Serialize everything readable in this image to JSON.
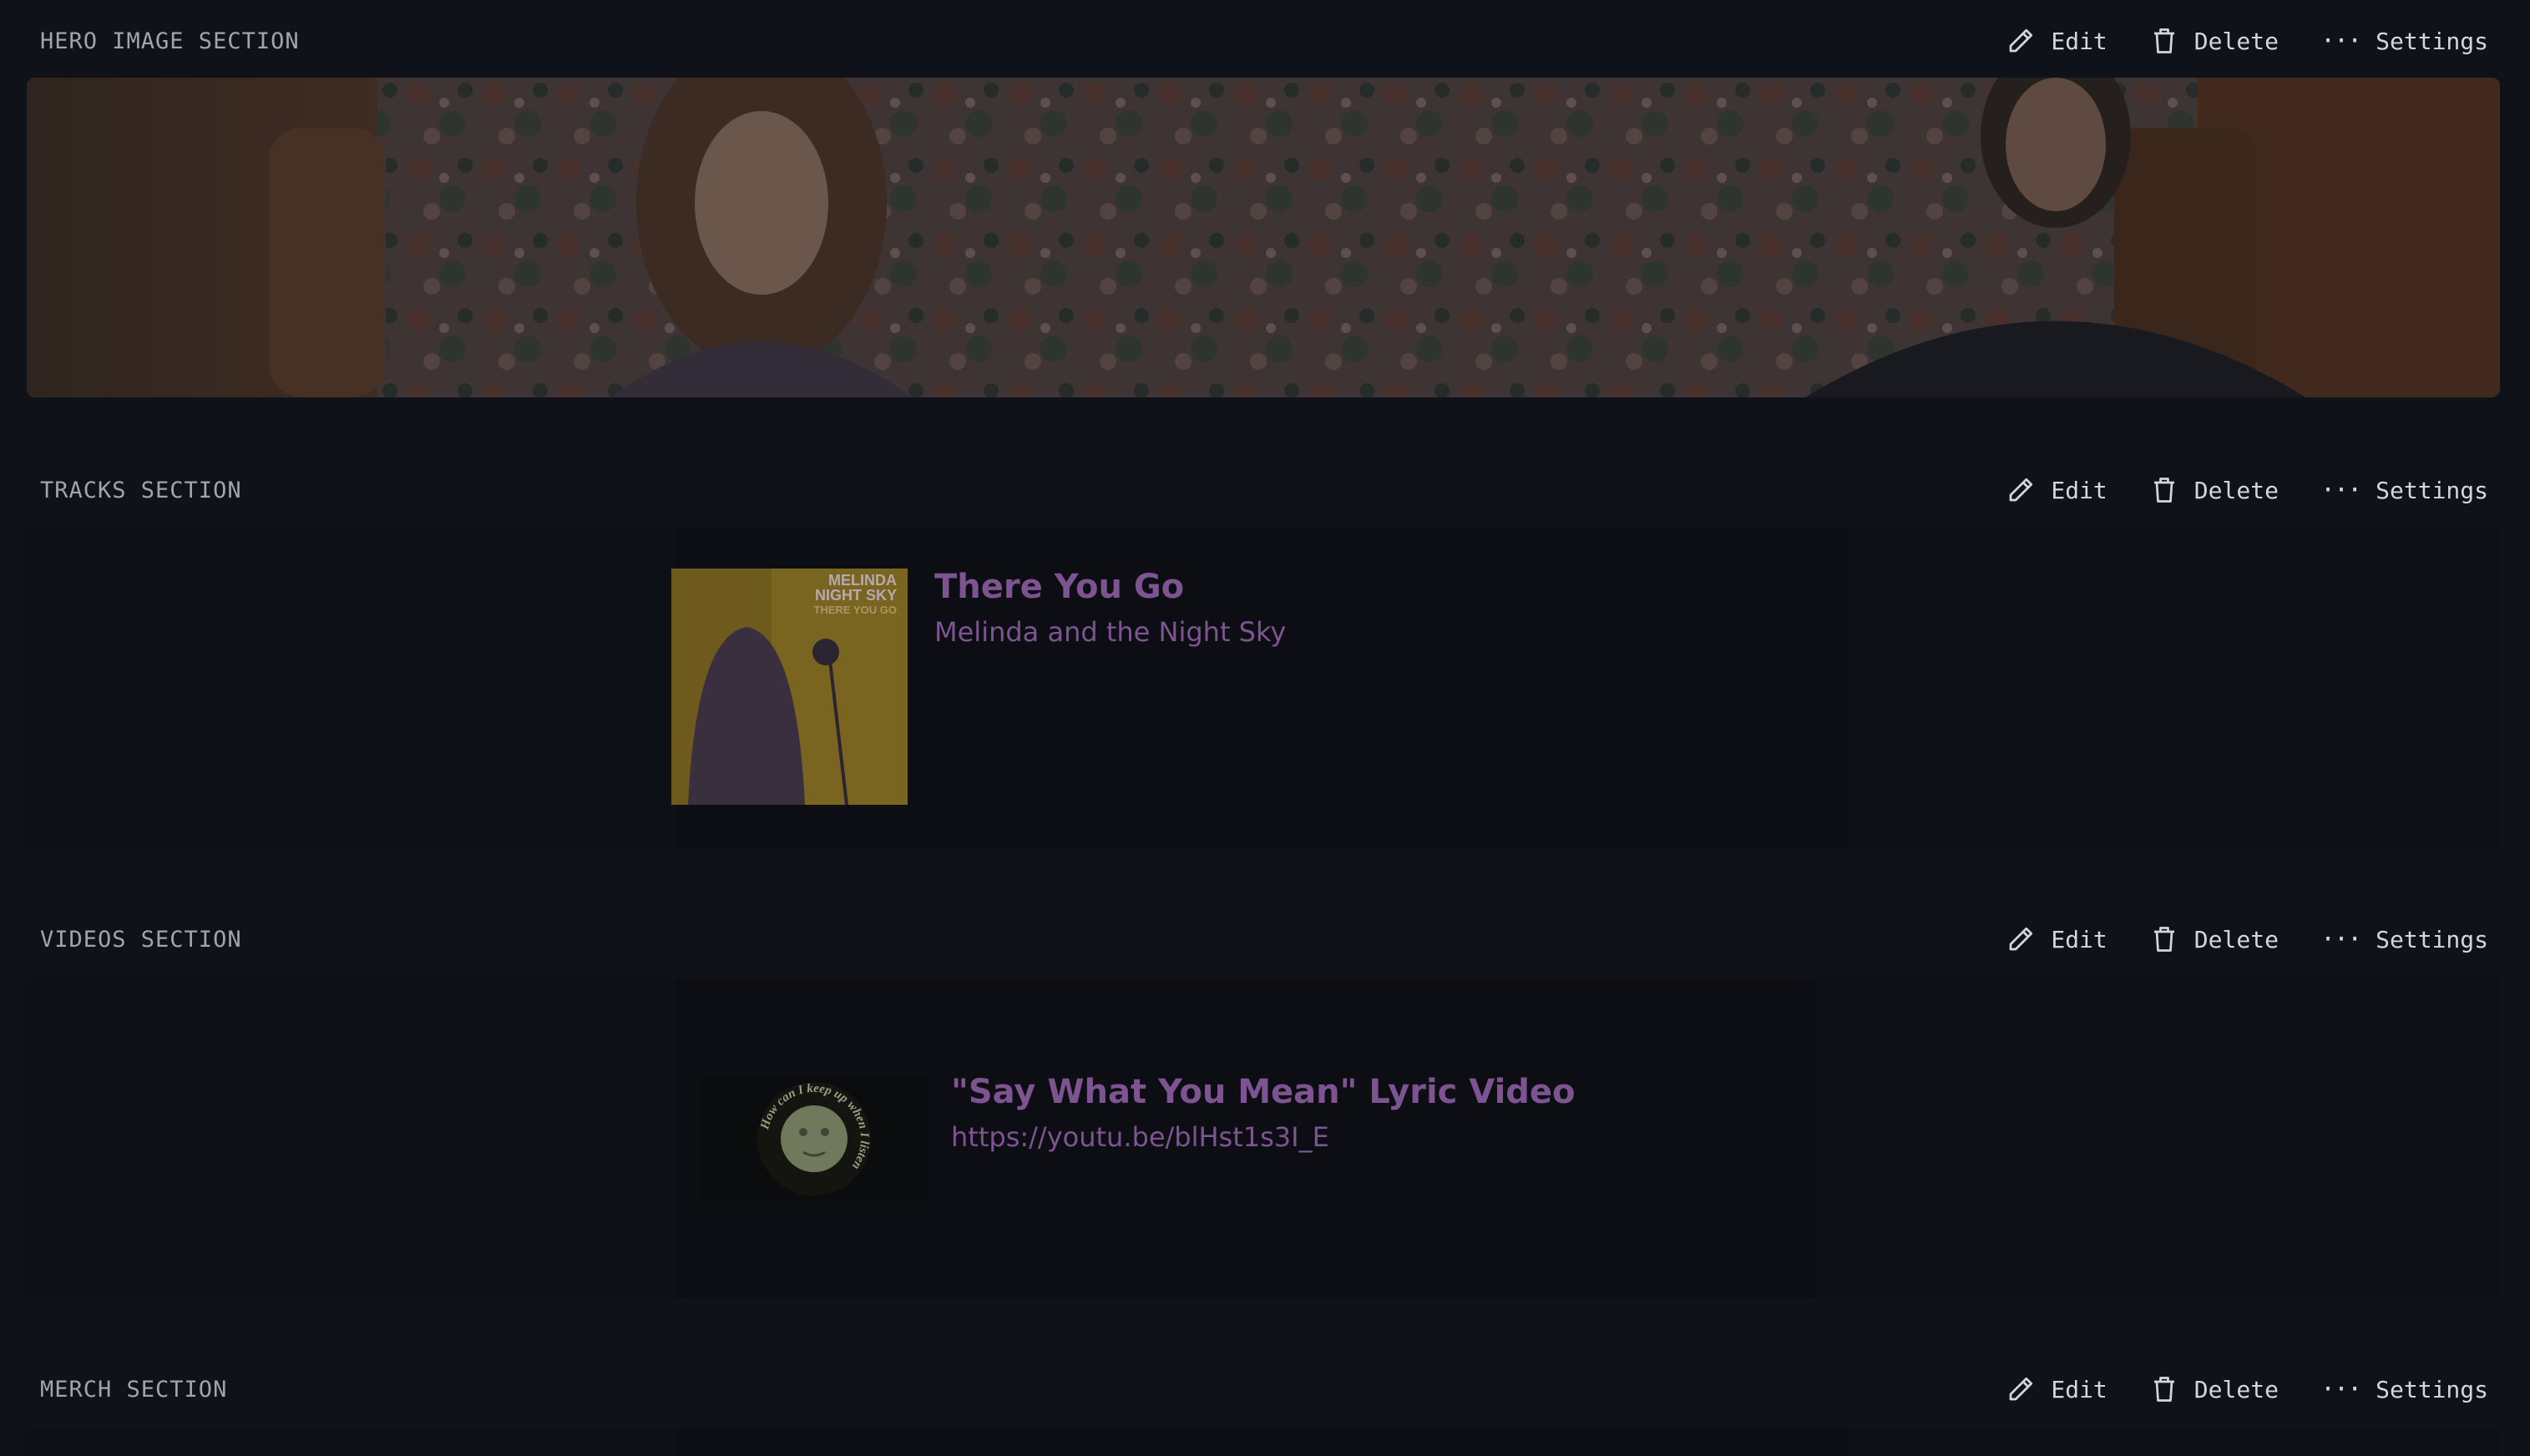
{
  "actions": {
    "edit": "Edit",
    "delete": "Delete",
    "settings": "Settings"
  },
  "sections": {
    "hero": {
      "title": "HERO IMAGE SECTION"
    },
    "tracks": {
      "title": "TRACKS SECTION"
    },
    "videos": {
      "title": "VIDEOS SECTION"
    },
    "merch": {
      "title": "MERCH SECTION"
    }
  },
  "track": {
    "title": "There You Go",
    "artist": "Melinda and the Night Sky",
    "cover_text": [
      "MELINDA",
      "NIGHT SKY",
      "THERE YOU GO"
    ]
  },
  "video": {
    "title": "\"Say What You Mean\" Lyric Video",
    "url": "https://youtu.be/blHst1s3I_E",
    "thumb_text": "How can I keep up when I listen"
  },
  "colors": {
    "background": "#0f1219",
    "accent": "#7d5491",
    "label": "#a0a4ae",
    "action": "#d4d6db"
  }
}
